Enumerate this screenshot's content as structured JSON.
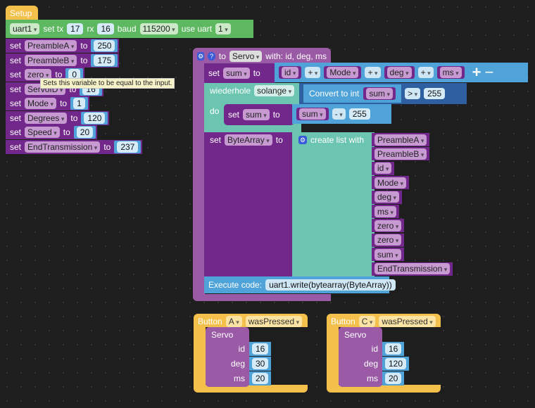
{
  "setup": {
    "title": "Setup",
    "uart": "uart1",
    "set_tx": "set tx",
    "tx": "17",
    "rx_label": "rx",
    "rx": "16",
    "baud_label": "baud",
    "baud": "115200",
    "use_uart": "use uart",
    "uart_num": "1"
  },
  "sets": [
    {
      "var": "PreambleA",
      "value": "250"
    },
    {
      "var": "PreambleB",
      "value": "175"
    },
    {
      "var": "zero",
      "value": "0"
    },
    {
      "var": "ServoID",
      "value": "16"
    },
    {
      "var": "Mode",
      "value": "1"
    },
    {
      "var": "Degrees",
      "value": "120"
    },
    {
      "var": "Speed",
      "value": "20"
    },
    {
      "var": "EndTransmission",
      "value": "237"
    }
  ],
  "kw": {
    "set": "set",
    "to": "to",
    "plus": "+",
    "minus": "-",
    "gt": ">",
    "do": "do"
  },
  "tooltip": "Sets this variable to be equal to the input.",
  "proc": {
    "to": "to",
    "name": "Servo",
    "with": "with: id, deg, ms",
    "sum": "sum",
    "terms": [
      "id",
      "Mode",
      "deg",
      "ms"
    ],
    "repeat": "wiederhole",
    "repeat_mode": "solange",
    "convert": "Convert to int",
    "limit": "255",
    "sub": "255",
    "bytearray": "ByteArray",
    "create_list": "create list with",
    "list": [
      "PreambleA",
      "PreambleB",
      "id",
      "Mode",
      "deg",
      "ms",
      "zero",
      "zero",
      "sum",
      "EndTransmission"
    ],
    "exec_label": "Execute code:",
    "exec_code": "uart1.write(bytearray(ByteArray))"
  },
  "buttons": [
    {
      "label": "Button",
      "btn": "A",
      "event": "wasPressed",
      "call": "Servo",
      "params": [
        {
          "name": "id",
          "value": "16"
        },
        {
          "name": "deg",
          "value": "30"
        },
        {
          "name": "ms",
          "value": "20"
        }
      ]
    },
    {
      "label": "Button",
      "btn": "C",
      "event": "wasPressed",
      "call": "Servo",
      "params": [
        {
          "name": "id",
          "value": "16"
        },
        {
          "name": "deg",
          "value": "120"
        },
        {
          "name": "ms",
          "value": "20"
        }
      ]
    }
  ]
}
